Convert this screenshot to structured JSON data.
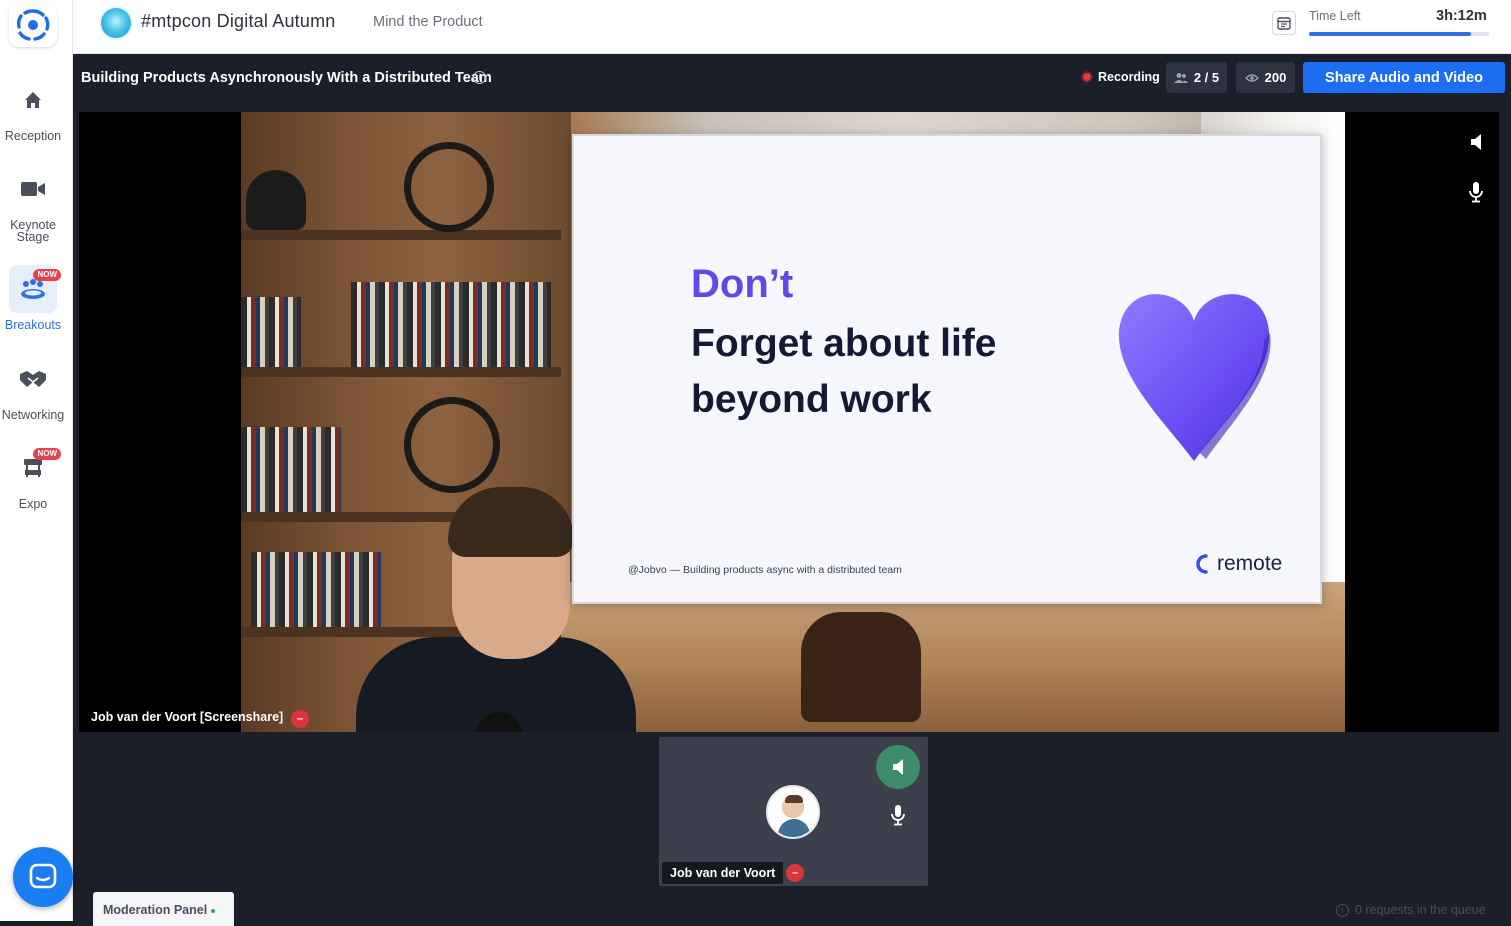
{
  "sidebar": {
    "items": [
      {
        "label": "Reception",
        "icon": "home-icon"
      },
      {
        "label": "Keynote Stage",
        "icon": "video-camera-icon"
      },
      {
        "label": "Breakouts",
        "icon": "people-table-icon",
        "badge": "NOW",
        "active": true
      },
      {
        "label": "Networking",
        "icon": "handshake-icon"
      },
      {
        "label": "Expo",
        "icon": "booth-icon",
        "badge": "NOW"
      }
    ]
  },
  "header": {
    "event_title": "#mtpcon Digital Autumn",
    "organizer": "Mind the Product",
    "time_left_label": "Time Left",
    "time_left_value": "3h:12m",
    "time_left_fraction": 0.9
  },
  "session": {
    "title": "Building Products Asynchronously With a Distributed Team",
    "recording_label": "Recording",
    "speakers_count": "2 / 5",
    "viewers_count": "200",
    "share_button_label": "Share Audio and Video"
  },
  "stage": {
    "screenshare_name": "Job van der Voort [Screenshare]",
    "slide": {
      "heading": "Don’t",
      "line1": "Forget about life",
      "line2": "beyond work",
      "footer": "@Jobvo — Building products async with a distributed team",
      "brand": "remote"
    }
  },
  "participant": {
    "name": "Job van der Voort"
  },
  "bottom": {
    "moderation_panel_label": "Moderation Panel",
    "queue_text": "0 requests in the queue"
  },
  "colors": {
    "accent": "#1c6ef2",
    "sidebar_active": "#2f6fe8",
    "background": "#1b1f2a",
    "slide_heading": "#6248e6",
    "recording": "#e23a3a"
  }
}
